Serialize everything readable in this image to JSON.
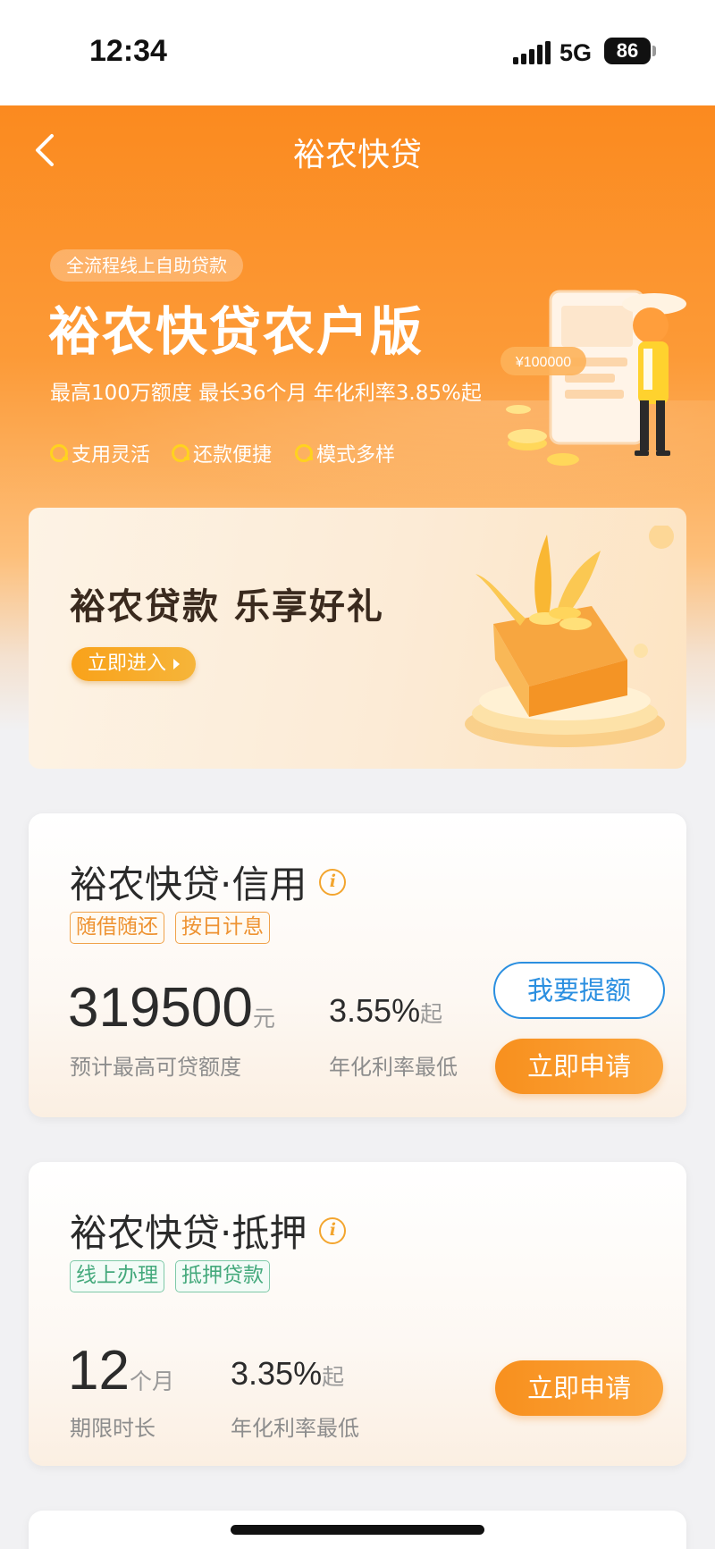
{
  "status_bar": {
    "time": "12:34",
    "network": "5G",
    "battery": "86"
  },
  "nav": {
    "back_icon": "chevron-left-icon",
    "title": "裕农快贷"
  },
  "hero": {
    "pill": "全流程线上自助贷款",
    "title": "裕农快贷农户版",
    "subtitle": "最高100万额度 最长36个月 年化利率3.85%起",
    "features": [
      "支用灵活",
      "还款便捷",
      "模式多样"
    ],
    "illustration_amount": "¥100000"
  },
  "banner": {
    "title": "裕农贷款 乐享好礼",
    "button_label": "立即进入"
  },
  "cards": [
    {
      "title": "裕农快贷·信用",
      "tags": [
        "随借随还",
        "按日计息"
      ],
      "amount": "319500",
      "amount_unit": "元",
      "amount_caption": "预计最高可贷额度",
      "rate": "3.55%",
      "rate_suffix": "起",
      "rate_caption": "年化利率最低",
      "raise_button": "我要提额",
      "apply_button": "立即申请"
    },
    {
      "title": "裕农快贷·抵押",
      "tags": [
        "线上办理",
        "抵押贷款"
      ],
      "term": "12",
      "term_unit": "个月",
      "term_caption": "期限时长",
      "rate": "3.35%",
      "rate_suffix": "起",
      "rate_caption": "年化利率最低",
      "apply_button": "立即申请"
    }
  ],
  "colors": {
    "primary_orange": "#fb8a1f",
    "button_blue": "#2b8fe0",
    "tag_orange": "#ee9332",
    "tag_green": "#44a97c"
  }
}
